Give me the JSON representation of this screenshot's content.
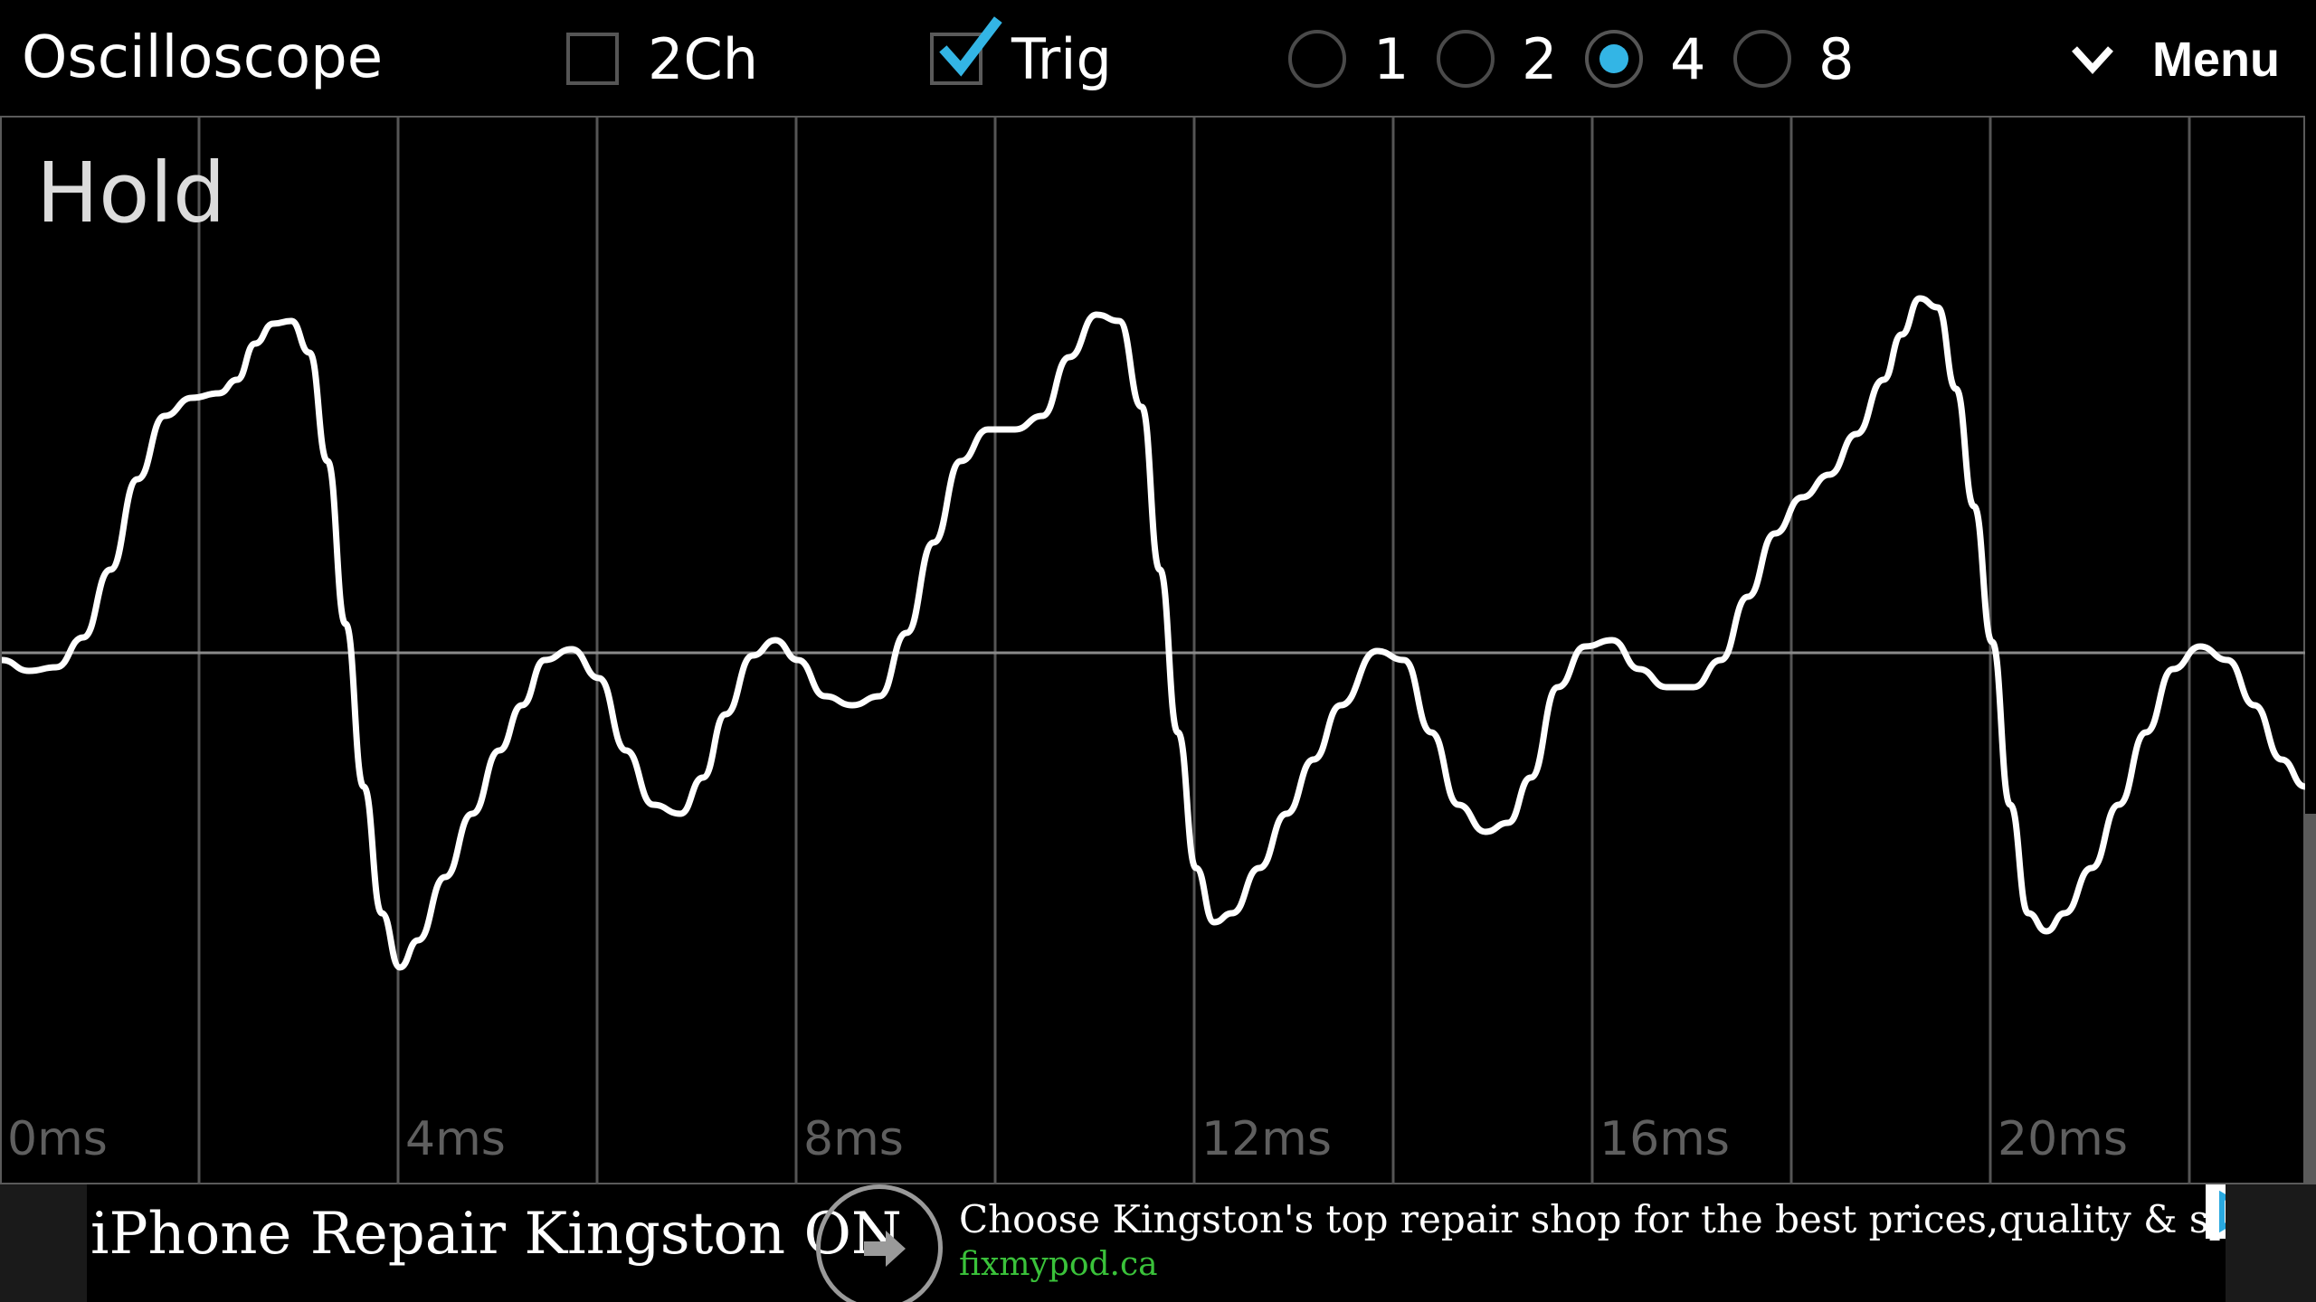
{
  "app": {
    "title": "Oscilloscope"
  },
  "toolbar": {
    "two_channel": {
      "label": "2Ch",
      "checked": false
    },
    "trigger": {
      "label": "Trig",
      "checked": true
    },
    "gain_options": [
      {
        "label": "1",
        "selected": false
      },
      {
        "label": "2",
        "selected": false
      },
      {
        "label": "4",
        "selected": true
      },
      {
        "label": "8",
        "selected": false
      }
    ],
    "menu_label": "Menu",
    "menu_icon": "chevron-down-icon"
  },
  "scope": {
    "status": "Hold",
    "time_labels": [
      "0ms",
      "4ms",
      "8ms",
      "12ms",
      "16ms",
      "20ms"
    ],
    "colors": {
      "trace": "#ffffff",
      "grid": "#555555",
      "accent": "#33b5e5"
    }
  },
  "ad": {
    "title": "iPhone Repair Kingston ON",
    "description": "Choose Kingston's top repair shop for the best prices,quality & speed",
    "url": "fixmypod.ca",
    "go_icon": "arrow-right-icon",
    "adchoices_icon": "adchoices-icon",
    "close_icon": "close-icon"
  }
}
